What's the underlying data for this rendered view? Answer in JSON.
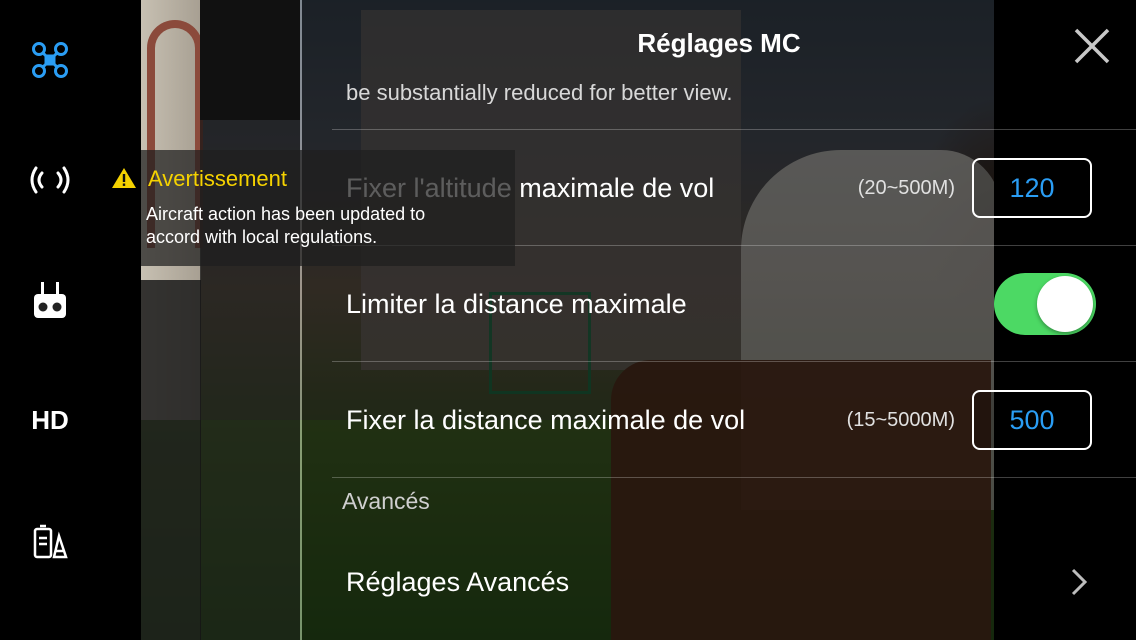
{
  "header": {
    "title": "Réglages MC",
    "partial_text": "be substantially reduced for better view."
  },
  "sidebar": {
    "items": [
      {
        "icon": "aircraft-icon",
        "selected": true
      },
      {
        "icon": "signal-icon",
        "selected": false
      },
      {
        "icon": "remote-controller-icon",
        "selected": false
      },
      {
        "icon": "hd-icon",
        "label": "HD",
        "selected": false
      },
      {
        "icon": "battery-icon",
        "selected": false
      }
    ]
  },
  "settings": {
    "max_altitude": {
      "label": "Fixer l'altitude maximale de vol",
      "range": "(20~500M)",
      "value": "120"
    },
    "limit_distance": {
      "label": "Limiter la distance maximale",
      "enabled": true
    },
    "max_distance": {
      "label": "Fixer la distance maximale de vol",
      "range": "(15~5000M)",
      "value": "500"
    },
    "section_title": "Avancés",
    "advanced": {
      "label": "Réglages Avancés"
    }
  },
  "warning": {
    "title": "Avertissement",
    "message_line1": "Aircraft action has been updated to",
    "message_line2": "accord with local regulations."
  },
  "colors": {
    "accent_blue": "#2a9df4",
    "toggle_green": "#4cd964",
    "warning_yellow": "#f5d200"
  }
}
